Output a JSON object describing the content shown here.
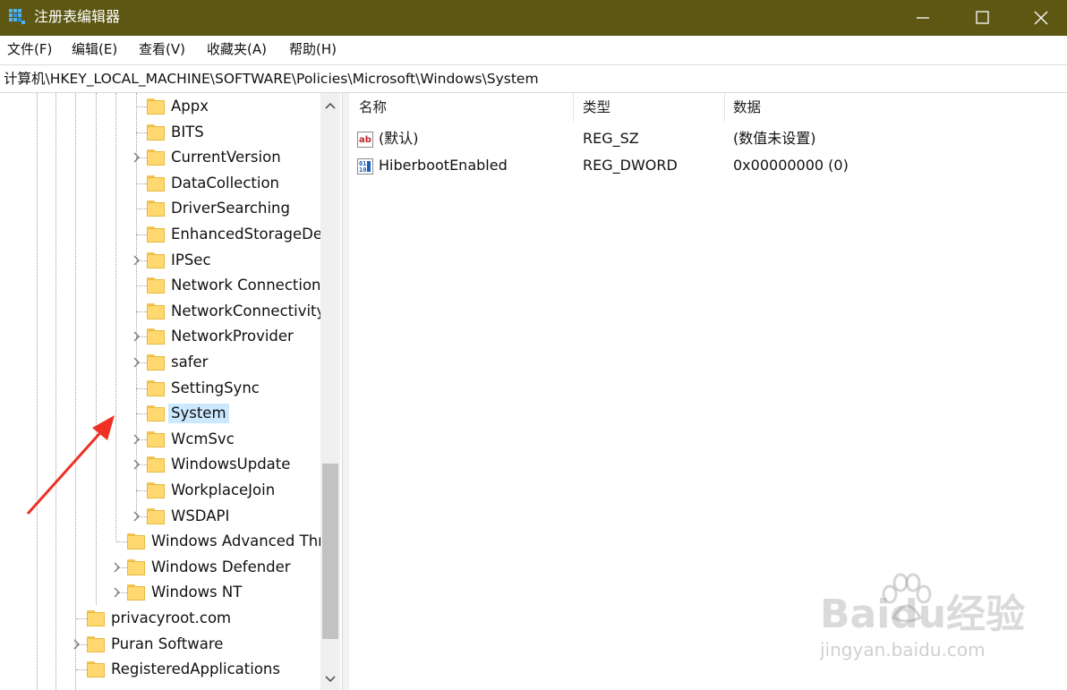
{
  "window": {
    "title": "注册表编辑器",
    "title_bar_color": "#5d5713"
  },
  "menu": [
    "文件(F)",
    "编辑(E)",
    "查看(V)",
    "收藏夹(A)",
    "帮助(H)"
  ],
  "address": "计算机\\HKEY_LOCAL_MACHINE\\SOFTWARE\\Policies\\Microsoft\\Windows\\System",
  "tree": [
    {
      "label": "Appx",
      "expandable": false
    },
    {
      "label": "BITS",
      "expandable": false
    },
    {
      "label": "CurrentVersion",
      "expandable": true
    },
    {
      "label": "DataCollection",
      "expandable": false
    },
    {
      "label": "DriverSearching",
      "expandable": false
    },
    {
      "label": "EnhancedStorageDe",
      "expandable": false
    },
    {
      "label": "IPSec",
      "expandable": true
    },
    {
      "label": "Network Connection",
      "expandable": false
    },
    {
      "label": "NetworkConnectivity",
      "expandable": false
    },
    {
      "label": "NetworkProvider",
      "expandable": true
    },
    {
      "label": "safer",
      "expandable": true
    },
    {
      "label": "SettingSync",
      "expandable": false
    },
    {
      "label": "System",
      "expandable": false,
      "selected": true
    },
    {
      "label": "WcmSvc",
      "expandable": true
    },
    {
      "label": "WindowsUpdate",
      "expandable": true
    },
    {
      "label": "WorkplaceJoin",
      "expandable": false
    },
    {
      "label": "WSDAPI",
      "expandable": true
    },
    {
      "label": "Windows Advanced Thr",
      "expandable": false
    },
    {
      "label": "Windows Defender",
      "expandable": true
    },
    {
      "label": "Windows NT",
      "expandable": true
    },
    {
      "label": "privacyroot.com",
      "expandable": false
    },
    {
      "label": "Puran Software",
      "expandable": true
    },
    {
      "label": "RegisteredApplications",
      "expandable": false
    }
  ],
  "columns": [
    "名称",
    "类型",
    "数据"
  ],
  "values": [
    {
      "icon": "string-value-icon",
      "name": "(默认)",
      "type": "REG_SZ",
      "data": "(数值未设置)"
    },
    {
      "icon": "binary-value-icon",
      "name": "HiberbootEnabled",
      "type": "REG_DWORD",
      "data": "0x00000000 (0)"
    }
  ],
  "selection_color": "#cce8ff",
  "annotation_arrow_color": "#ee3124",
  "watermark": {
    "brand": "Baidu经验",
    "url": "jingyan.baidu.com"
  }
}
